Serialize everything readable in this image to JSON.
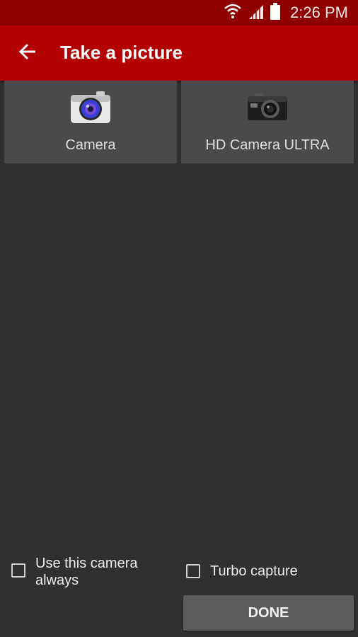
{
  "status_bar": {
    "time": "2:26 PM",
    "icons": [
      "wifi-icon",
      "signal-icon",
      "battery-icon"
    ]
  },
  "app_bar": {
    "title": "Take a picture",
    "back_icon": "back-arrow-icon"
  },
  "apps": [
    {
      "label": "Camera",
      "icon": "camera-icon"
    },
    {
      "label": "HD Camera ULTRA",
      "icon": "hd-camera-icon"
    }
  ],
  "options": {
    "always_label": "Use this camera always",
    "always_checked": false,
    "turbo_label": "Turbo capture",
    "turbo_checked": false
  },
  "done_label": "DONE",
  "colors": {
    "status_bar": "#8e0000",
    "app_bar": "#b30000",
    "background": "#303030",
    "tile": "#4a4a4a",
    "button": "#5c5c5c"
  }
}
